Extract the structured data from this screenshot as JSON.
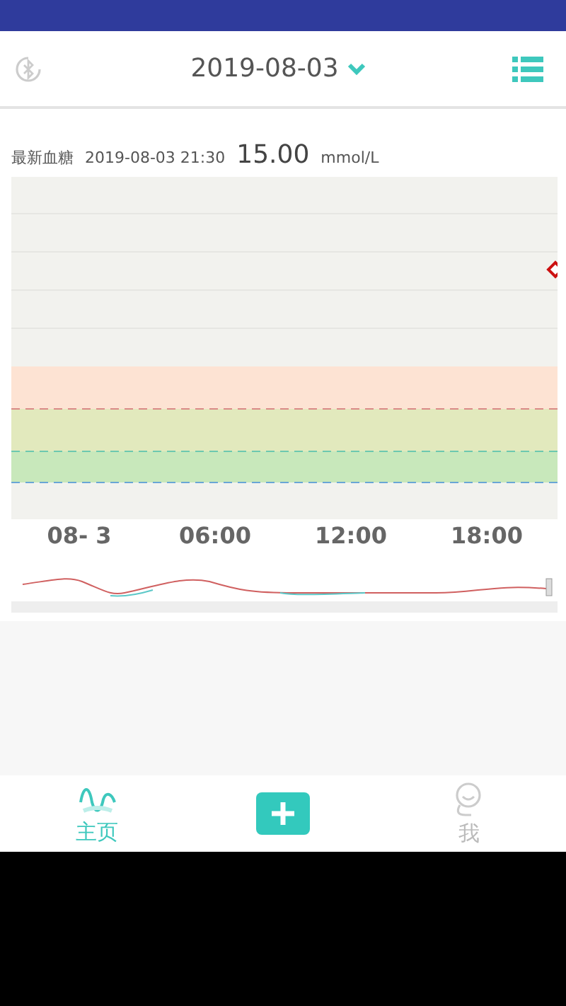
{
  "header": {
    "date": "2019-08-03"
  },
  "latest": {
    "label": "最新血糖",
    "time": "2019-08-03 21:30",
    "value": "15.00",
    "unit": "mmol/L"
  },
  "chart": {
    "time_labels": [
      "08- 3",
      "06:00",
      "12:00",
      "18:00"
    ]
  },
  "tabs": [
    {
      "kind": "home",
      "label": "主页",
      "selected": true
    },
    {
      "kind": "add"
    },
    {
      "kind": "me",
      "label": "我",
      "selected": false
    }
  ]
}
